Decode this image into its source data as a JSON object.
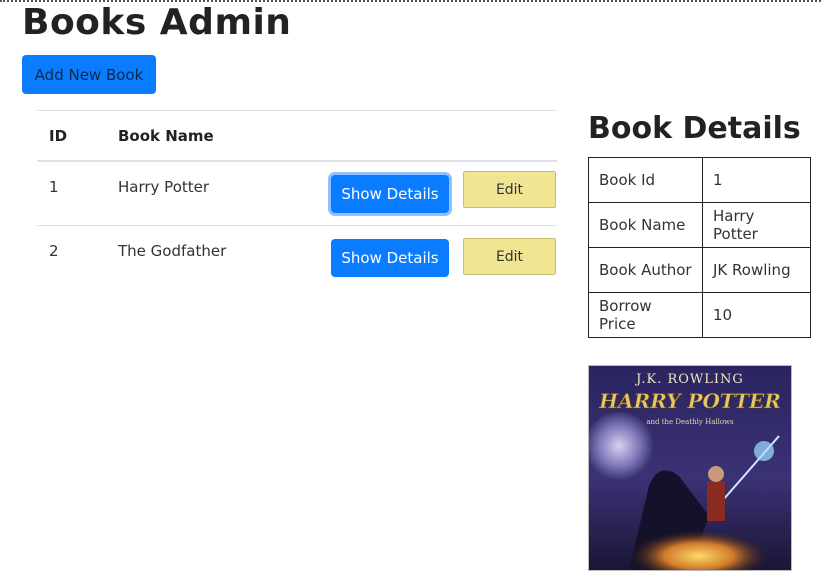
{
  "header": {
    "title": "Books Admin",
    "add_button_label": "Add New Book"
  },
  "books_table": {
    "columns": {
      "id": "ID",
      "name": "Book Name"
    },
    "rows": [
      {
        "id": "1",
        "name": "Harry Potter",
        "show_label": "Show Details",
        "edit_label": "Edit"
      },
      {
        "id": "2",
        "name": "The Godfather",
        "show_label": "Show Details",
        "edit_label": "Edit"
      }
    ]
  },
  "details": {
    "title": "Book Details",
    "rows": [
      {
        "key": "Book Id",
        "value": "1"
      },
      {
        "key": "Book Name",
        "value": "Harry Potter"
      },
      {
        "key": "Book Author",
        "value": "JK Rowling"
      },
      {
        "key": "Borrow Price",
        "value": "10"
      }
    ],
    "cover": {
      "author": "J.K. ROWLING",
      "title": "HARRY POTTER",
      "subtitle": "and the Deathly Hallows"
    }
  },
  "colors": {
    "primary": "#0a7cff",
    "edit": "#efe593"
  }
}
